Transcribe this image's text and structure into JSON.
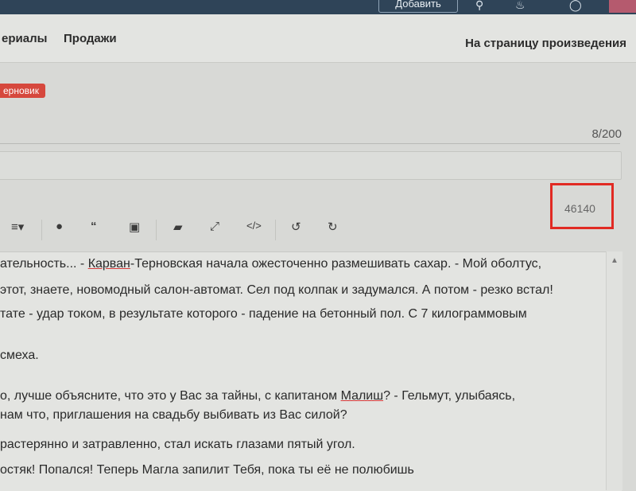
{
  "topbar": {
    "add_label": "Добавить",
    "icons": [
      "search-icon",
      "bell-icon",
      "chat-icon",
      "user-avatar"
    ]
  },
  "nav": {
    "materials": "ериалы",
    "sales": "Продажи",
    "to_work_page": "На страницу произведения"
  },
  "editor": {
    "draft_badge": "ерновик",
    "title_counter": "8/200",
    "char_count": "46140",
    "toolbar_icons": [
      "align-icon",
      "drop-icon",
      "quote-icon",
      "image-icon",
      "eraser-icon",
      "expand-icon",
      "code-icon",
      "undo-icon",
      "redo-icon"
    ],
    "lines": [
      {
        "t1": "ательность... - ",
        "u": "Карван",
        "t2": "-Терновская начала ожесточенно размешивать сахар. - Мой оболтус,"
      },
      {
        "t1": "этот, знаете, новомодный салон-автомат. Сел под колпак и задумался. А потом - резко встал!"
      },
      {
        "t1": "тате - удар током, в результате которого - падение на бетонный пол. С 7 килограммовым"
      },
      {
        "t1": "смеха."
      },
      {
        "t1": "о, лучше объясните, что это у Вас за тайны, с капитаном ",
        "u": "Малиш",
        "t2": "? - Гельмут, улыбаясь,"
      },
      {
        "t1": " нам что, приглашения на свадьбу выбивать из Вас силой?"
      },
      {
        "t1": " растерянно и затравленно, стал искать глазами пятый угол."
      },
      {
        "t1": "остяк! Попался! Теперь Магла запилит Тебя, пока ты её не полюбишь"
      }
    ]
  }
}
